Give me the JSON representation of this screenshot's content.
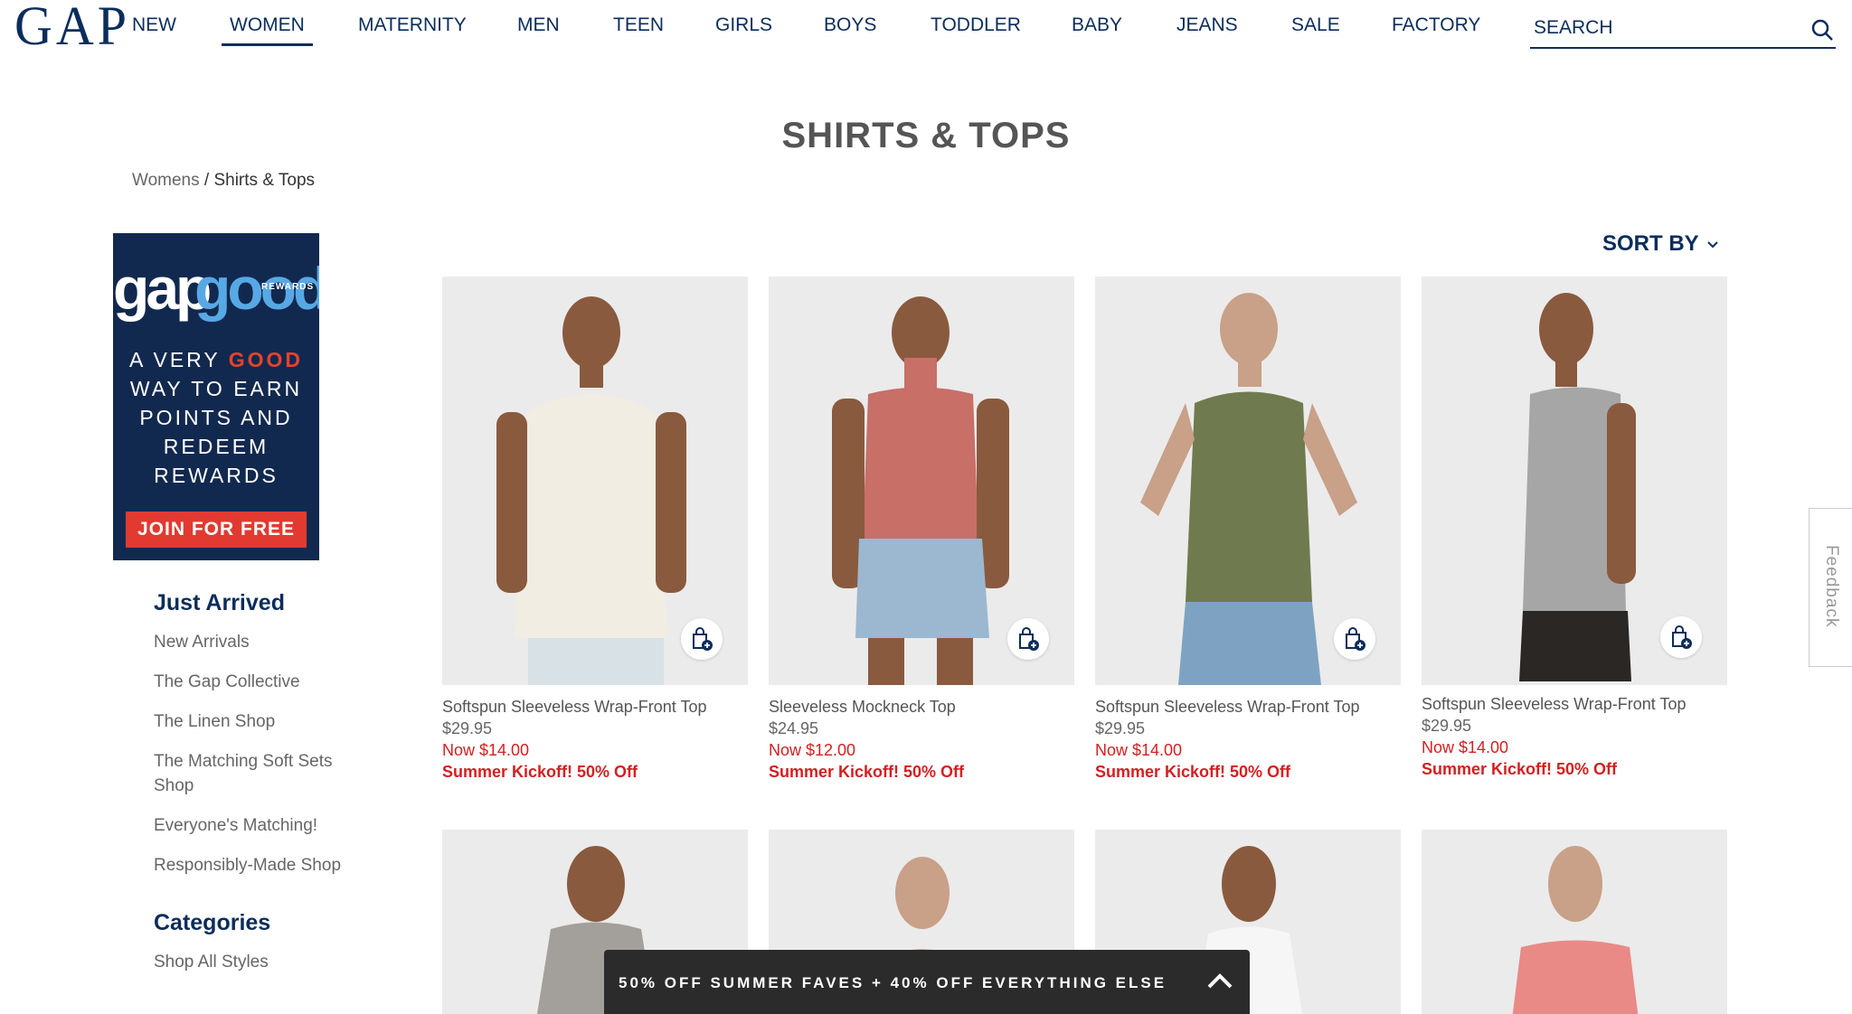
{
  "brand": {
    "logo_text": "GAP"
  },
  "nav": {
    "items": [
      "NEW",
      "WOMEN",
      "MATERNITY",
      "MEN",
      "TEEN",
      "GIRLS",
      "BOYS",
      "TODDLER",
      "BABY",
      "JEANS",
      "SALE",
      "FACTORY"
    ],
    "active": "WOMEN"
  },
  "search": {
    "placeholder": "SEARCH"
  },
  "page": {
    "title": "SHIRTS & TOPS",
    "breadcrumb": {
      "parent": "Womens",
      "separator": " / ",
      "current": "Shirts & Tops"
    },
    "sort_label": "SORT BY"
  },
  "promo": {
    "logo_text": "gapgood",
    "logo_sub": "REWARDS",
    "line1_a": "A VERY ",
    "line1_b": "GOOD",
    "line2": "WAY TO EARN",
    "line3": "POINTS AND",
    "line4": "REDEEM",
    "line5": "REWARDS",
    "button": "JOIN FOR FREE"
  },
  "sidebar": {
    "section1": "Just Arrived",
    "links1": [
      "New Arrivals",
      "The Gap Collective",
      "The Linen Shop",
      "The Matching Soft Sets Shop",
      "Everyone's Matching!",
      "Responsibly-Made Shop"
    ],
    "section2": "Categories",
    "links2": [
      "Shop All Styles"
    ]
  },
  "products": [
    {
      "name": "Softspun Sleeveless Wrap-Front Top",
      "price": "$29.95",
      "sale": "Now $14.00",
      "promo": "Summer Kickoff! 50% Off",
      "color": "#f1ede3"
    },
    {
      "name": "Sleeveless Mockneck Top",
      "price": "$24.95",
      "sale": "Now $12.00",
      "promo": "Summer Kickoff! 50% Off",
      "color": "#c86f68"
    },
    {
      "name": "Softspun Sleeveless Wrap-Front Top",
      "price": "$29.95",
      "sale": "Now $14.00",
      "promo": "Summer Kickoff! 50% Off",
      "color": "#6f7b4e"
    },
    {
      "name": "Softspun Sleeveless Wrap-Front Top",
      "price": "$29.95",
      "sale": "Now $14.00",
      "promo": "Summer Kickoff! 50% Off",
      "color": "#a6a6a6"
    }
  ],
  "banner": {
    "text": "50% OFF SUMMER FAVES + 40% OFF EVERYTHING ELSE"
  },
  "feedback": {
    "label": "Feedback"
  },
  "colors": {
    "navy": "#0b2d5b",
    "sale_red": "#d32020",
    "promo_bg": "#12294f",
    "promo_button": "#e23a30"
  }
}
